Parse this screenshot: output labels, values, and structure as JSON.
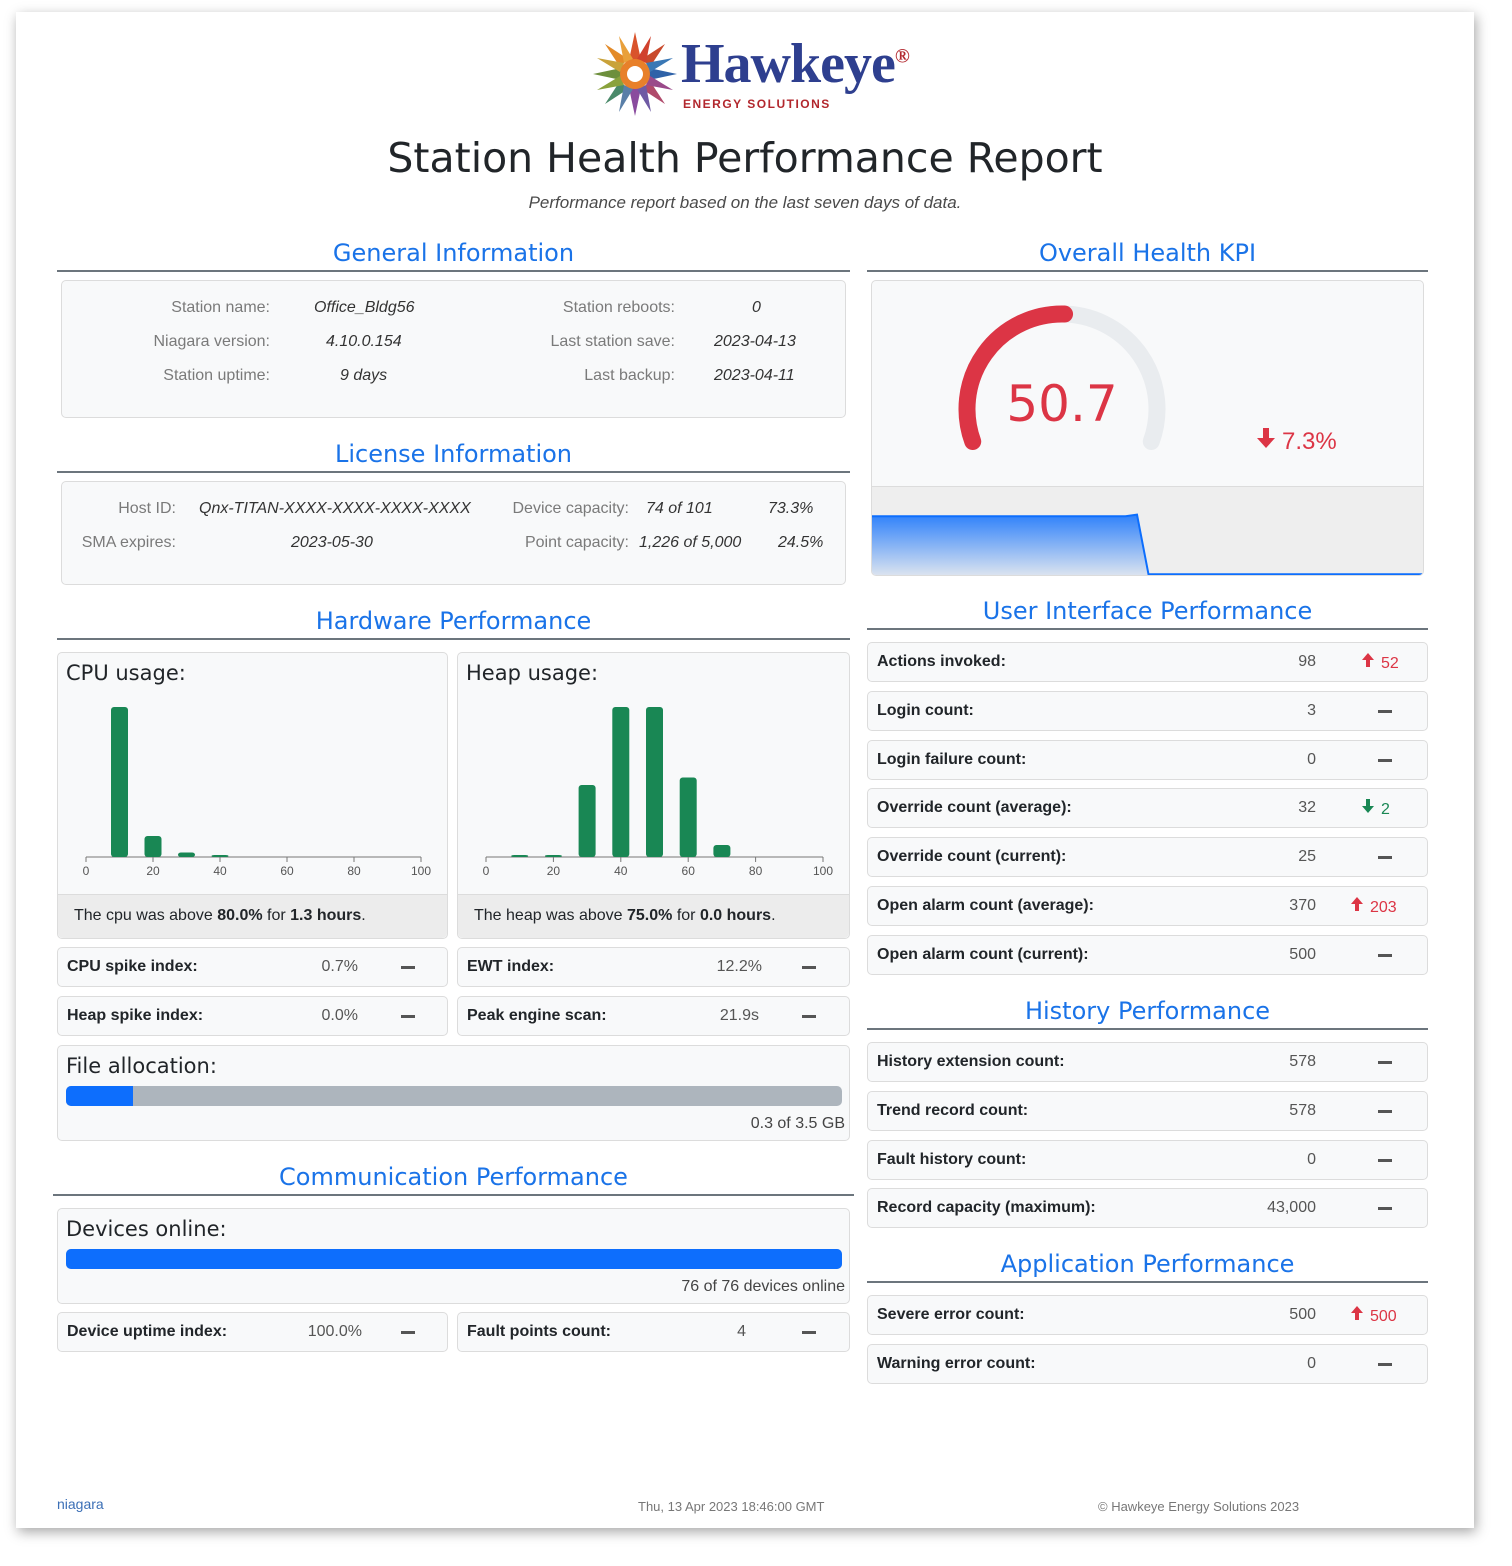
{
  "header": {
    "brand": "Hawkeye",
    "brand_sub": "ENERGY SOLUTIONS",
    "title": "Station Health Performance Report",
    "subtitle": "Performance report based on the last seven days of data."
  },
  "general": {
    "title": "General Information",
    "station_name_label": "Station name:",
    "station_name": "Office_Bldg56",
    "niagara_version_label": "Niagara version:",
    "niagara_version": "4.10.0.154",
    "uptime_label": "Station uptime:",
    "uptime": "9 days",
    "reboots_label": "Station reboots:",
    "reboots": "0",
    "last_save_label": "Last station save:",
    "last_save": "2023-04-13",
    "last_backup_label": "Last backup:",
    "last_backup": "2023-04-11"
  },
  "license": {
    "title": "License Information",
    "host_id_label": "Host ID:",
    "host_id": "Qnx-TITAN-XXXX-XXXX-XXXX-XXXX",
    "sma_label": "SMA expires:",
    "sma": "2023-05-30",
    "device_cap_label": "Device capacity:",
    "device_cap": "74 of 101",
    "device_cap_pct": "73.3%",
    "point_cap_label": "Point capacity:",
    "point_cap": "1,226 of 5,000",
    "point_cap_pct": "24.5%"
  },
  "kpi": {
    "title": "Overall Health KPI",
    "value": "50.7",
    "gauge_fraction": 0.507,
    "change": "7.3%",
    "change_dir": "down",
    "gauge_color": "#dc3545",
    "spark_color": "#0d6efd"
  },
  "hardware": {
    "title": "Hardware Performance",
    "cpu": {
      "title": "CPU usage:",
      "foot_pre": "The cpu was above ",
      "threshold": "80.0%",
      "foot_mid": " for ",
      "duration": "1.3 hours",
      "foot_end": "."
    },
    "heap": {
      "title": "Heap usage:",
      "foot_pre": "The heap was above ",
      "threshold": "75.0%",
      "foot_mid": " for ",
      "duration": "0.0 hours",
      "foot_end": "."
    },
    "cpu_spike_label": "CPU spike index:",
    "cpu_spike": "0.7%",
    "heap_spike_label": "Heap spike index:",
    "heap_spike": "0.0%",
    "ewt_label": "EWT index:",
    "ewt": "12.2%",
    "peak_scan_label": "Peak engine scan:",
    "peak_scan": "21.9s",
    "file_alloc_title": "File allocation:",
    "file_alloc_fraction": 0.086,
    "file_alloc_text": "0.3 of 3.5 GB"
  },
  "communication": {
    "title": "Communication Performance",
    "devices_title": "Devices online:",
    "devices_fraction": 1.0,
    "devices_text": "76 of 76 devices online",
    "uptime_label": "Device uptime index:",
    "uptime": "100.0%",
    "fault_label": "Fault points count:",
    "fault": "4"
  },
  "ui_perf": {
    "title": "User Interface Performance",
    "rows": [
      {
        "label": "Actions invoked:",
        "value": "98",
        "trend": "up",
        "delta": "52"
      },
      {
        "label": "Login count:",
        "value": "3",
        "trend": "none",
        "delta": ""
      },
      {
        "label": "Login failure count:",
        "value": "0",
        "trend": "none",
        "delta": ""
      },
      {
        "label": "Override count (average):",
        "value": "32",
        "trend": "down",
        "delta": "2"
      },
      {
        "label": "Override count (current):",
        "value": "25",
        "trend": "none",
        "delta": ""
      },
      {
        "label": "Open alarm count (average):",
        "value": "370",
        "trend": "up",
        "delta": "203"
      },
      {
        "label": "Open alarm count (current):",
        "value": "500",
        "trend": "none",
        "delta": ""
      }
    ]
  },
  "history_perf": {
    "title": "History Performance",
    "rows": [
      {
        "label": "History extension count:",
        "value": "578",
        "trend": "none",
        "delta": ""
      },
      {
        "label": "Trend record count:",
        "value": "578",
        "trend": "none",
        "delta": ""
      },
      {
        "label": "Fault history count:",
        "value": "0",
        "trend": "none",
        "delta": ""
      },
      {
        "label": "Record capacity (maximum):",
        "value": "43,000",
        "trend": "none",
        "delta": ""
      }
    ]
  },
  "app_perf": {
    "title": "Application Performance",
    "rows": [
      {
        "label": "Severe error count:",
        "value": "500",
        "trend": "up",
        "delta": "500"
      },
      {
        "label": "Warning error count:",
        "value": "0",
        "trend": "none",
        "delta": ""
      }
    ]
  },
  "chart_data": [
    {
      "type": "bar",
      "title": "CPU usage:",
      "x": [
        10,
        20,
        30,
        40,
        50,
        60,
        70,
        80,
        90
      ],
      "values": [
        100,
        14,
        3,
        1,
        0,
        0,
        0,
        0,
        0
      ],
      "xlim": [
        0,
        100
      ],
      "xticks": [
        "0",
        "20",
        "40",
        "60",
        "80",
        "100"
      ],
      "color": "#198754"
    },
    {
      "type": "bar",
      "title": "Heap usage:",
      "x": [
        10,
        20,
        30,
        40,
        50,
        60,
        70,
        80,
        90
      ],
      "values": [
        1,
        1,
        48,
        100,
        100,
        53,
        8,
        0,
        0
      ],
      "xlim": [
        0,
        100
      ],
      "xticks": [
        "0",
        "20",
        "40",
        "60",
        "80",
        "100"
      ],
      "color": "#198754"
    },
    {
      "type": "area",
      "title": "",
      "values": [
        72,
        72,
        72,
        72,
        72,
        72,
        72,
        72,
        72,
        72,
        72,
        72,
        72,
        72,
        72,
        72,
        72,
        72,
        72,
        72,
        72,
        72,
        72,
        74,
        2,
        2,
        2,
        2,
        2,
        2,
        2,
        2,
        2,
        2,
        2,
        2,
        2,
        2,
        2,
        2,
        2,
        2,
        2,
        2,
        2,
        2,
        2,
        2,
        2
      ],
      "color": "#0d6efd"
    }
  ],
  "footer": {
    "left": "niagara",
    "center": "Thu, 13 Apr 2023 18:46:00 GMT",
    "right": "© Hawkeye Energy Solutions 2023"
  }
}
